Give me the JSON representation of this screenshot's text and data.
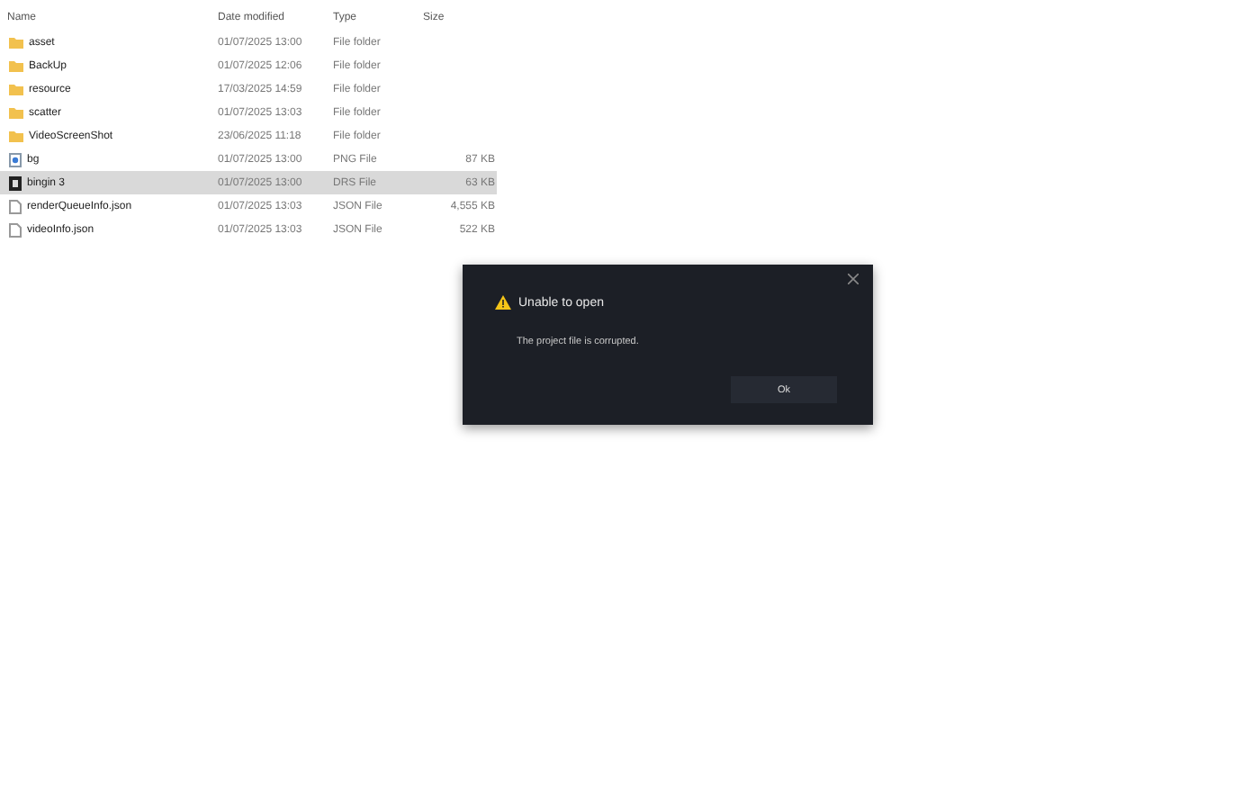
{
  "columns": [
    "Name",
    "Date modified",
    "Type",
    "Size"
  ],
  "files": [
    {
      "kind": "folder",
      "name": "asset",
      "date": "01/07/2025 13:00",
      "type": "File folder",
      "selected": false
    },
    {
      "kind": "folder",
      "name": "BackUp",
      "date": "01/07/2025 12:06",
      "type": "File folder",
      "selected": false
    },
    {
      "kind": "folder",
      "name": "resource",
      "date": "17/03/2025 14:59",
      "type": "File folder",
      "selected": false
    },
    {
      "kind": "folder",
      "name": "scatter",
      "date": "01/07/2025 13:03",
      "type": "File folder",
      "selected": false
    },
    {
      "kind": "folder",
      "name": "VideoScreenShot",
      "date": "23/06/2025 11:18",
      "type": "File folder",
      "selected": false
    },
    {
      "kind": "image",
      "name": "bg",
      "date": "01/07/2025 13:00",
      "type": "PNG File",
      "size": "87 KB",
      "selected": false
    },
    {
      "kind": "project",
      "name": "bingin 3",
      "date": "01/07/2025 13:00",
      "type": "DRS File",
      "size": "63 KB",
      "selected": true
    },
    {
      "kind": "file",
      "name": "renderQueueInfo.json",
      "date": "01/07/2025 13:03",
      "type": "JSON File",
      "size": "4,555 KB",
      "selected": false
    },
    {
      "kind": "file",
      "name": "videoInfo.json",
      "date": "01/07/2025 13:03",
      "type": "JSON File",
      "size": "522 KB",
      "selected": false
    }
  ],
  "dialog": {
    "title": "Unable to open",
    "message": "The project file is corrupted.",
    "button": "Ok"
  }
}
